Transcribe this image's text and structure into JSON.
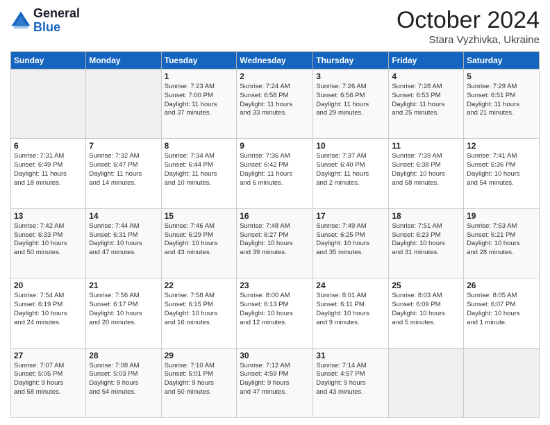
{
  "header": {
    "logo_line1": "General",
    "logo_line2": "Blue",
    "month_title": "October 2024",
    "subtitle": "Stara Vyzhivka, Ukraine"
  },
  "weekdays": [
    "Sunday",
    "Monday",
    "Tuesday",
    "Wednesday",
    "Thursday",
    "Friday",
    "Saturday"
  ],
  "weeks": [
    [
      {
        "day": "",
        "info": ""
      },
      {
        "day": "",
        "info": ""
      },
      {
        "day": "1",
        "info": "Sunrise: 7:23 AM\nSunset: 7:00 PM\nDaylight: 11 hours\nand 37 minutes."
      },
      {
        "day": "2",
        "info": "Sunrise: 7:24 AM\nSunset: 6:58 PM\nDaylight: 11 hours\nand 33 minutes."
      },
      {
        "day": "3",
        "info": "Sunrise: 7:26 AM\nSunset: 6:56 PM\nDaylight: 11 hours\nand 29 minutes."
      },
      {
        "day": "4",
        "info": "Sunrise: 7:28 AM\nSunset: 6:53 PM\nDaylight: 11 hours\nand 25 minutes."
      },
      {
        "day": "5",
        "info": "Sunrise: 7:29 AM\nSunset: 6:51 PM\nDaylight: 11 hours\nand 21 minutes."
      }
    ],
    [
      {
        "day": "6",
        "info": "Sunrise: 7:31 AM\nSunset: 6:49 PM\nDaylight: 11 hours\nand 18 minutes."
      },
      {
        "day": "7",
        "info": "Sunrise: 7:32 AM\nSunset: 6:47 PM\nDaylight: 11 hours\nand 14 minutes."
      },
      {
        "day": "8",
        "info": "Sunrise: 7:34 AM\nSunset: 6:44 PM\nDaylight: 11 hours\nand 10 minutes."
      },
      {
        "day": "9",
        "info": "Sunrise: 7:36 AM\nSunset: 6:42 PM\nDaylight: 11 hours\nand 6 minutes."
      },
      {
        "day": "10",
        "info": "Sunrise: 7:37 AM\nSunset: 6:40 PM\nDaylight: 11 hours\nand 2 minutes."
      },
      {
        "day": "11",
        "info": "Sunrise: 7:39 AM\nSunset: 6:38 PM\nDaylight: 10 hours\nand 58 minutes."
      },
      {
        "day": "12",
        "info": "Sunrise: 7:41 AM\nSunset: 6:36 PM\nDaylight: 10 hours\nand 54 minutes."
      }
    ],
    [
      {
        "day": "13",
        "info": "Sunrise: 7:42 AM\nSunset: 6:33 PM\nDaylight: 10 hours\nand 50 minutes."
      },
      {
        "day": "14",
        "info": "Sunrise: 7:44 AM\nSunset: 6:31 PM\nDaylight: 10 hours\nand 47 minutes."
      },
      {
        "day": "15",
        "info": "Sunrise: 7:46 AM\nSunset: 6:29 PM\nDaylight: 10 hours\nand 43 minutes."
      },
      {
        "day": "16",
        "info": "Sunrise: 7:48 AM\nSunset: 6:27 PM\nDaylight: 10 hours\nand 39 minutes."
      },
      {
        "day": "17",
        "info": "Sunrise: 7:49 AM\nSunset: 6:25 PM\nDaylight: 10 hours\nand 35 minutes."
      },
      {
        "day": "18",
        "info": "Sunrise: 7:51 AM\nSunset: 6:23 PM\nDaylight: 10 hours\nand 31 minutes."
      },
      {
        "day": "19",
        "info": "Sunrise: 7:53 AM\nSunset: 6:21 PM\nDaylight: 10 hours\nand 28 minutes."
      }
    ],
    [
      {
        "day": "20",
        "info": "Sunrise: 7:54 AM\nSunset: 6:19 PM\nDaylight: 10 hours\nand 24 minutes."
      },
      {
        "day": "21",
        "info": "Sunrise: 7:56 AM\nSunset: 6:17 PM\nDaylight: 10 hours\nand 20 minutes."
      },
      {
        "day": "22",
        "info": "Sunrise: 7:58 AM\nSunset: 6:15 PM\nDaylight: 10 hours\nand 16 minutes."
      },
      {
        "day": "23",
        "info": "Sunrise: 8:00 AM\nSunset: 6:13 PM\nDaylight: 10 hours\nand 12 minutes."
      },
      {
        "day": "24",
        "info": "Sunrise: 8:01 AM\nSunset: 6:11 PM\nDaylight: 10 hours\nand 9 minutes."
      },
      {
        "day": "25",
        "info": "Sunrise: 8:03 AM\nSunset: 6:09 PM\nDaylight: 10 hours\nand 5 minutes."
      },
      {
        "day": "26",
        "info": "Sunrise: 8:05 AM\nSunset: 6:07 PM\nDaylight: 10 hours\nand 1 minute."
      }
    ],
    [
      {
        "day": "27",
        "info": "Sunrise: 7:07 AM\nSunset: 5:05 PM\nDaylight: 9 hours\nand 58 minutes."
      },
      {
        "day": "28",
        "info": "Sunrise: 7:08 AM\nSunset: 5:03 PM\nDaylight: 9 hours\nand 54 minutes."
      },
      {
        "day": "29",
        "info": "Sunrise: 7:10 AM\nSunset: 5:01 PM\nDaylight: 9 hours\nand 50 minutes."
      },
      {
        "day": "30",
        "info": "Sunrise: 7:12 AM\nSunset: 4:59 PM\nDaylight: 9 hours\nand 47 minutes."
      },
      {
        "day": "31",
        "info": "Sunrise: 7:14 AM\nSunset: 4:57 PM\nDaylight: 9 hours\nand 43 minutes."
      },
      {
        "day": "",
        "info": ""
      },
      {
        "day": "",
        "info": ""
      }
    ]
  ]
}
